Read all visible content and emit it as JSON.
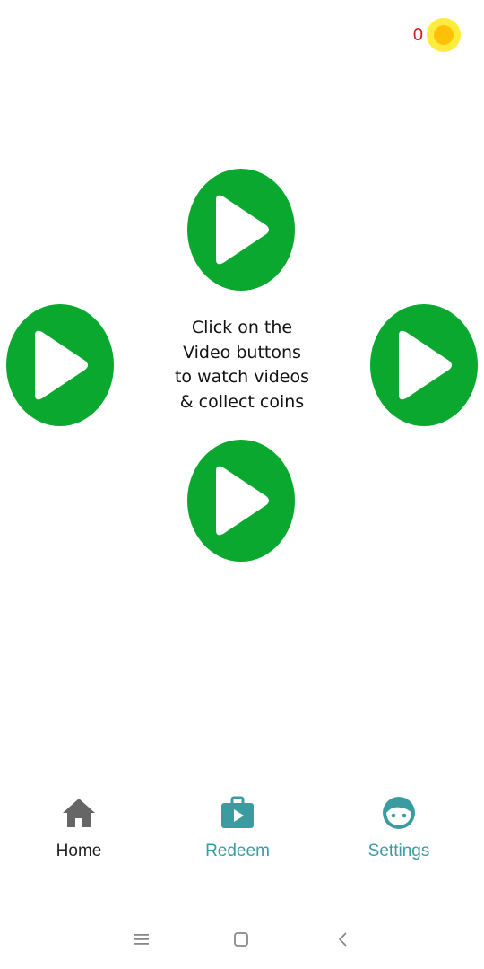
{
  "header": {
    "coin_count": "0"
  },
  "instructions": {
    "lines": [
      "Click on the",
      "Video buttons",
      "to watch videos",
      "& collect coins"
    ]
  },
  "bottom_nav": {
    "items": [
      {
        "label": "Home",
        "icon": "home-icon"
      },
      {
        "label": "Redeem",
        "icon": "redeem-icon"
      },
      {
        "label": "Settings",
        "icon": "face-icon"
      }
    ]
  },
  "colors": {
    "video_button": "#0aa82f",
    "coin_outer": "#ffeb3b",
    "coin_inner": "#ffc107",
    "coin_count": "#d61a1a",
    "nav_accent": "#3a9ca0",
    "nav_home_icon": "#666666"
  }
}
